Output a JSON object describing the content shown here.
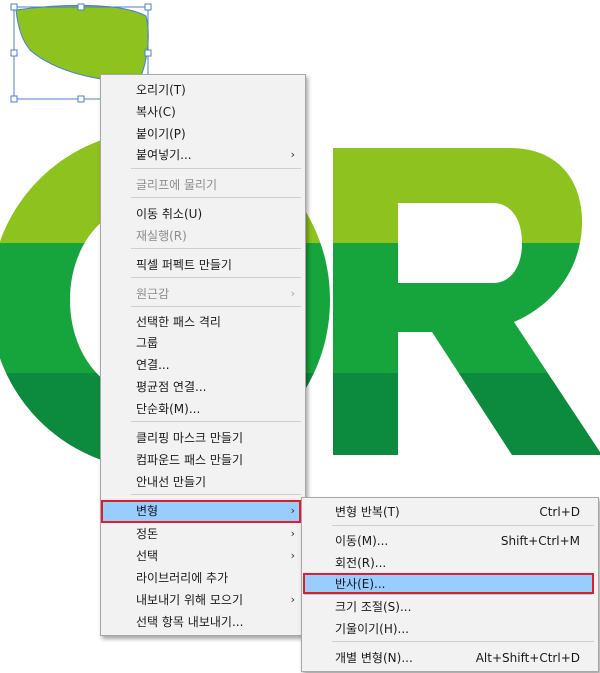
{
  "context_menu": {
    "items": [
      {
        "label": "오리기(T)",
        "enabled": true
      },
      {
        "label": "복사(C)",
        "enabled": true
      },
      {
        "label": "붙이기(P)",
        "enabled": true
      },
      {
        "label": "붙여넣기...",
        "enabled": true,
        "submenu": true
      },
      {
        "label": "글리프에 물리기",
        "enabled": false
      },
      {
        "label": "이동 취소(U)",
        "enabled": true
      },
      {
        "label": "재실행(R)",
        "enabled": false
      },
      {
        "label": "픽셀 퍼펙트 만들기",
        "enabled": true
      },
      {
        "label": "원근감",
        "enabled": false,
        "submenu": true
      },
      {
        "label": "선택한 패스 격리",
        "enabled": true
      },
      {
        "label": "그룹",
        "enabled": true
      },
      {
        "label": "연결...",
        "enabled": true
      },
      {
        "label": "평균점 연결...",
        "enabled": true
      },
      {
        "label": "단순화(M)...",
        "enabled": true
      },
      {
        "label": "클리핑 마스크 만들기",
        "enabled": true
      },
      {
        "label": "컴파운드 패스 만들기",
        "enabled": true
      },
      {
        "label": "안내선 만들기",
        "enabled": true
      },
      {
        "label": "변형",
        "enabled": true,
        "submenu": true,
        "highlighted": true
      },
      {
        "label": "정돈",
        "enabled": true,
        "submenu": true
      },
      {
        "label": "선택",
        "enabled": true,
        "submenu": true
      },
      {
        "label": "라이브러리에 추가",
        "enabled": true
      },
      {
        "label": "내보내기 위해 모으기",
        "enabled": true,
        "submenu": true
      },
      {
        "label": "선택 항목 내보내기...",
        "enabled": true
      }
    ],
    "arrow_glyph": "›"
  },
  "transform_submenu": {
    "items": [
      {
        "label": "변형 반복(T)",
        "shortcut": "Ctrl+D"
      },
      {
        "label": "이동(M)...",
        "shortcut": "Shift+Ctrl+M"
      },
      {
        "label": "회전(R)...",
        "shortcut": ""
      },
      {
        "label": "반사(E)...",
        "shortcut": "",
        "highlighted": true
      },
      {
        "label": "크기 조절(S)...",
        "shortcut": ""
      },
      {
        "label": "기울이기(H)...",
        "shortcut": ""
      },
      {
        "label": "개별 변형(N)...",
        "shortcut": "Alt+Shift+Ctrl+D"
      }
    ]
  },
  "colors": {
    "band_top": "#8dc21f",
    "band_mid": "#16a53c",
    "band_bottom": "#0c8a3e",
    "leaf_fill": "#8dc21f",
    "leaf_stroke": "#4a7fd4",
    "selection": "#4a7fd4",
    "menu_bg": "#f2f2f2",
    "menu_highlight": "#99ccff",
    "callout_red": "#e01d2b"
  },
  "icons": {
    "leaf": "leaf-icon",
    "logo_letters": "O R"
  }
}
